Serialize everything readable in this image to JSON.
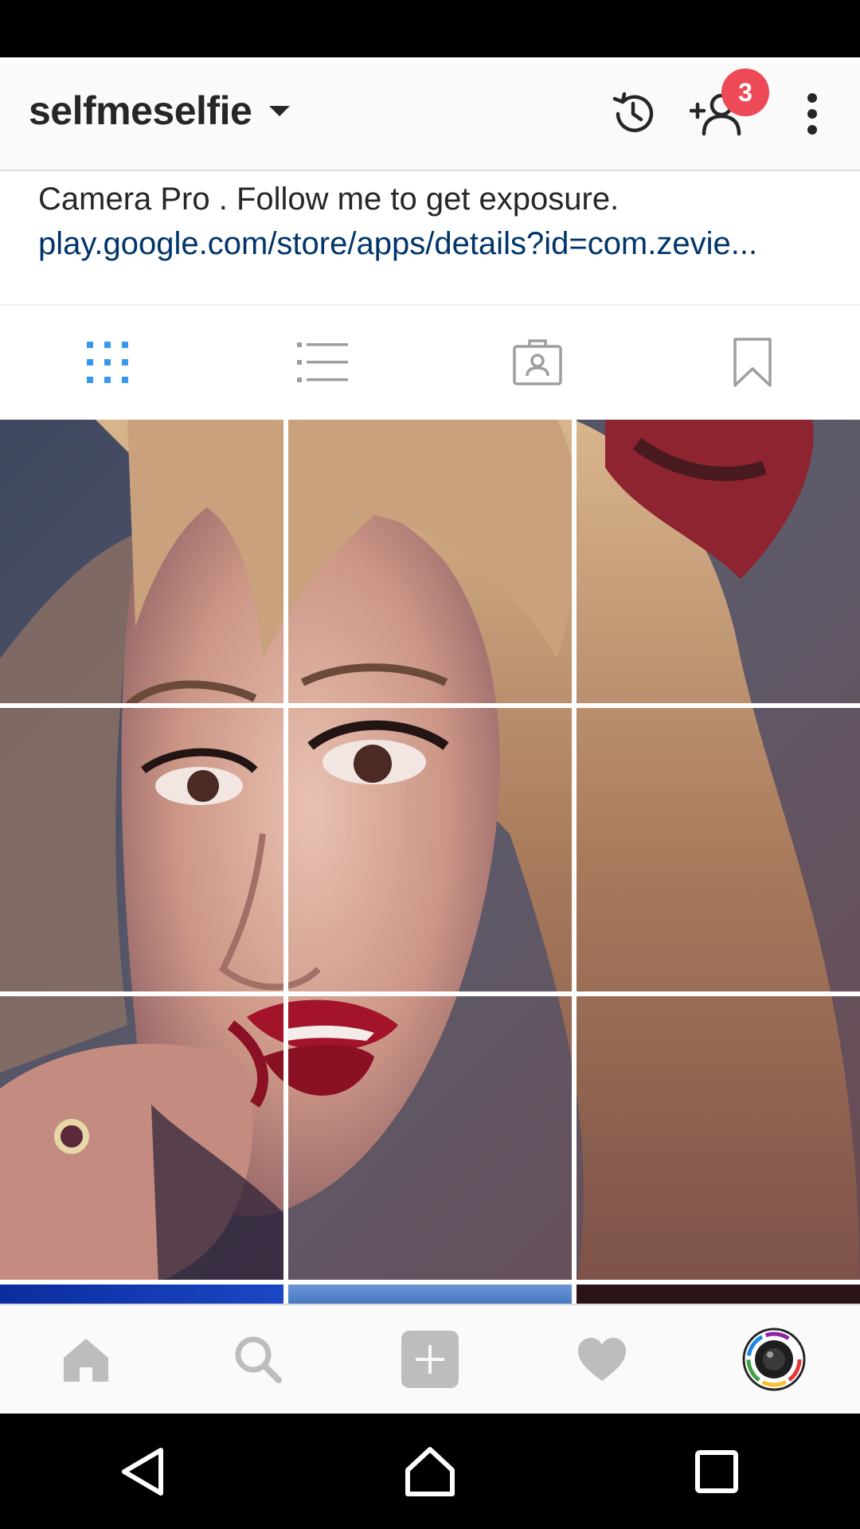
{
  "header": {
    "username": "selfmeselfie",
    "notification_count": "3"
  },
  "bio": {
    "text": "Camera Pro . Follow me to get exposure.",
    "link": "play.google.com/store/apps/details?id=com.zevie..."
  },
  "tabs": [
    {
      "icon": "grid-icon",
      "active": true
    },
    {
      "icon": "list-icon",
      "active": false
    },
    {
      "icon": "tagged-icon",
      "active": false
    },
    {
      "icon": "bookmark-icon",
      "active": false
    }
  ],
  "bottom_nav": [
    "home-icon",
    "search-icon",
    "add-post-icon",
    "heart-icon",
    "profile-avatar"
  ],
  "colors": {
    "accent": "#3897f0",
    "badge": "#ed4956",
    "link": "#003569",
    "icon_inactive": "#bdbdbd"
  }
}
